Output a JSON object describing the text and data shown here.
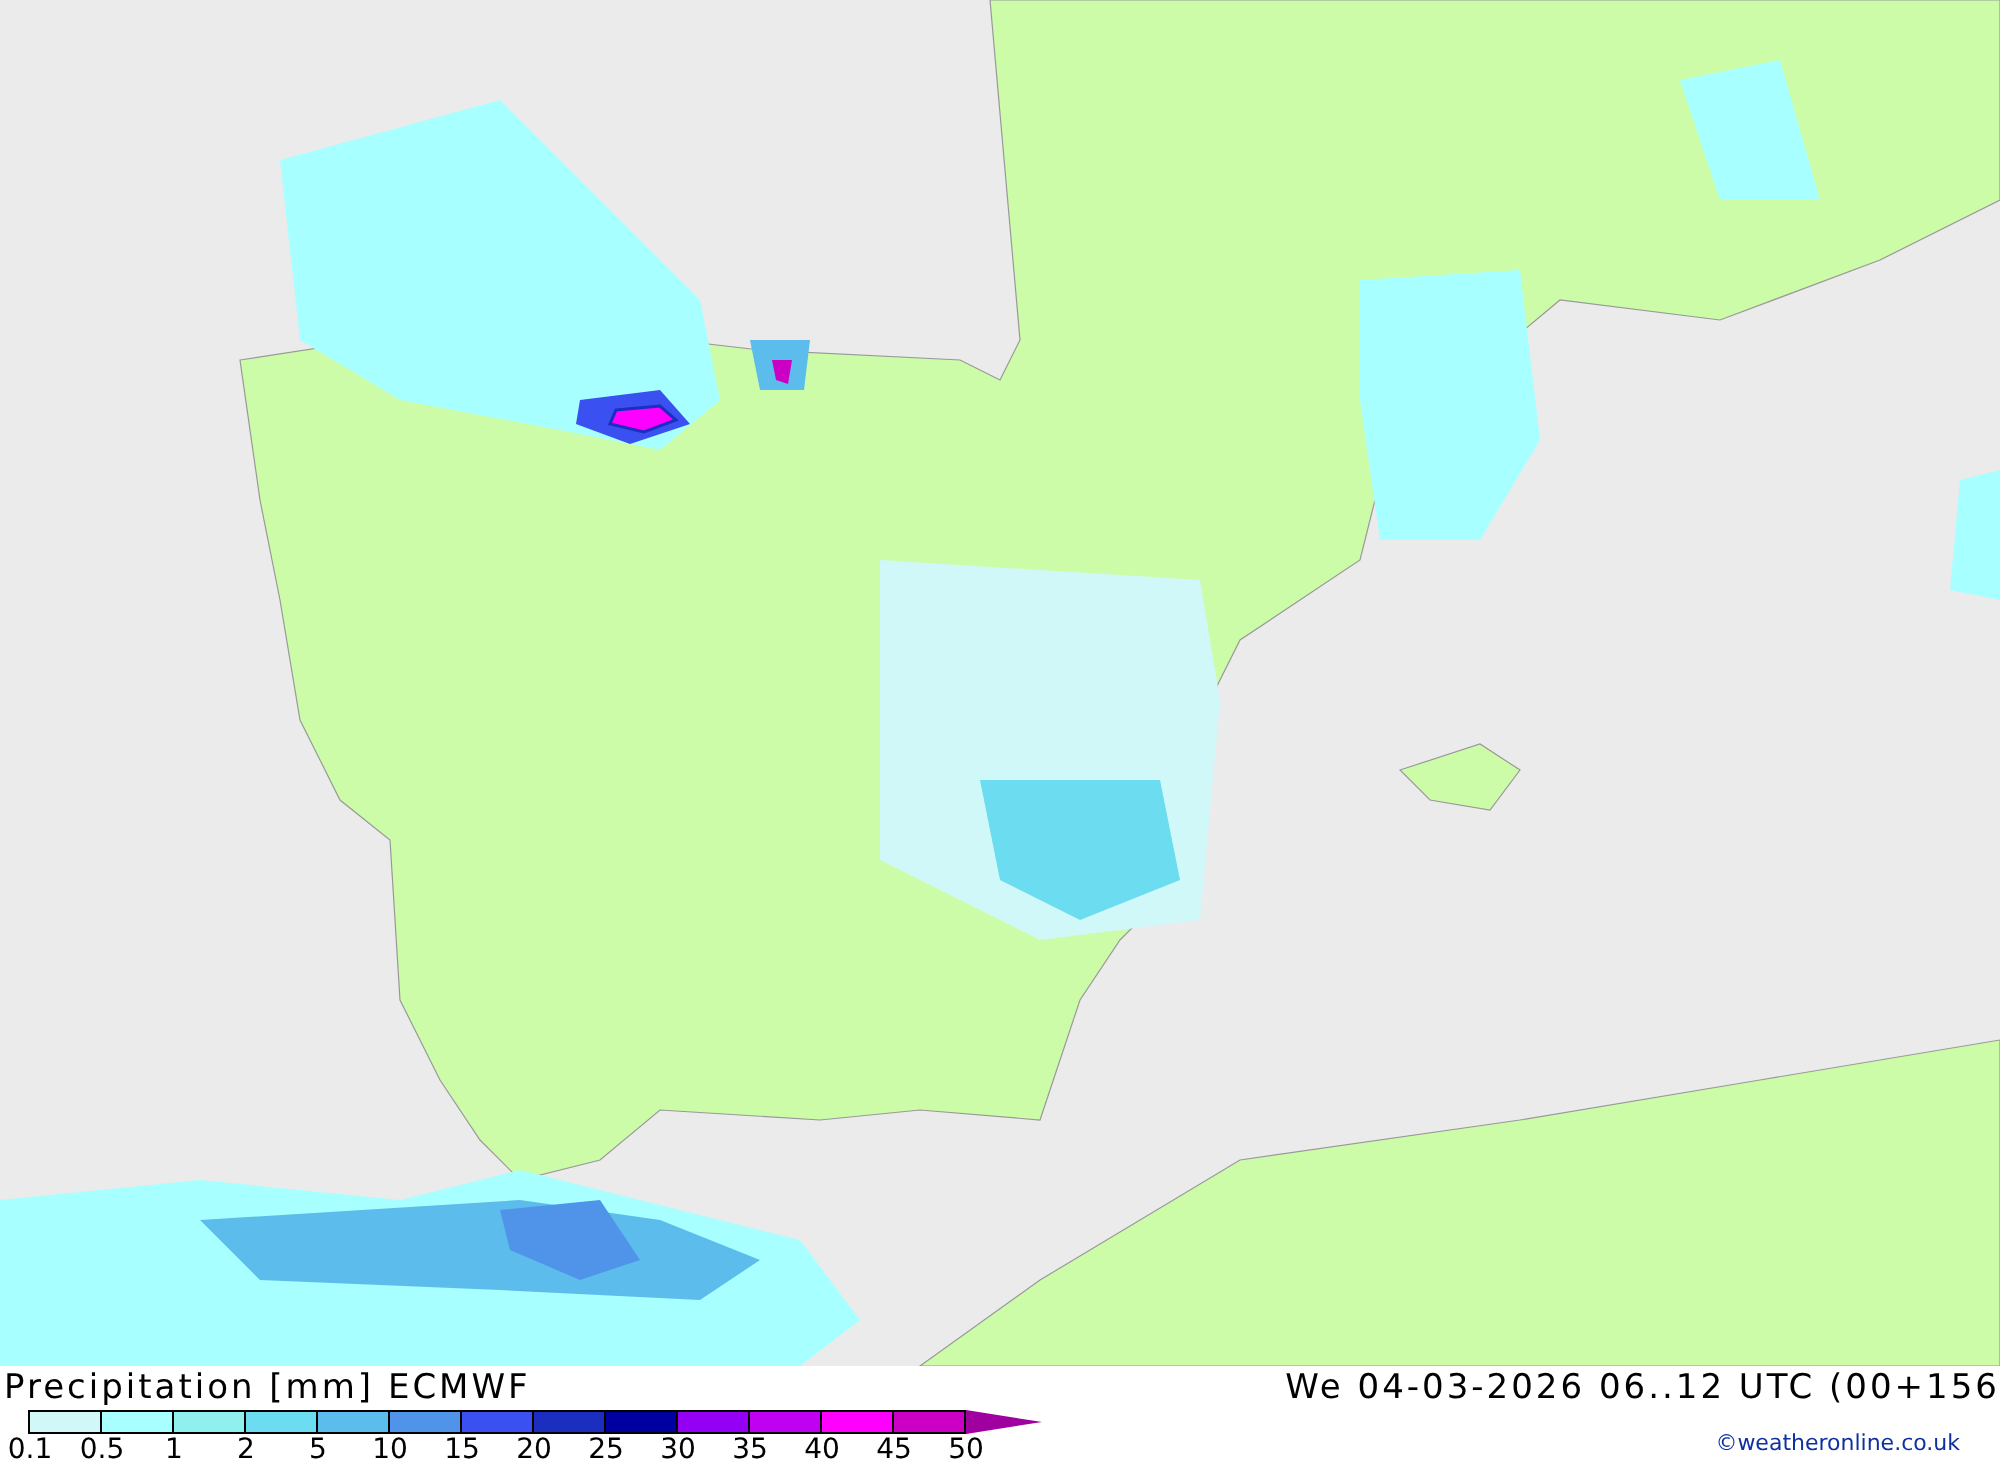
{
  "legend": {
    "title": "Precipitation [mm] ECMWF",
    "swatches": [
      {
        "color": "#d0f8f8"
      },
      {
        "color": "#a8ffff"
      },
      {
        "color": "#90f0ee"
      },
      {
        "color": "#6cdcf0"
      },
      {
        "color": "#5cbcec"
      },
      {
        "color": "#5094ea"
      },
      {
        "color": "#3a50f0"
      },
      {
        "color": "#1c2ec0"
      },
      {
        "color": "#0000a0"
      },
      {
        "color": "#9400f4"
      },
      {
        "color": "#c000f0"
      },
      {
        "color": "#ff00ff"
      },
      {
        "color": "#cc00c4"
      }
    ],
    "labels": [
      "0.1",
      "0.5",
      "1",
      "2",
      "5",
      "10",
      "15",
      "20",
      "25",
      "30",
      "35",
      "40",
      "45",
      "50"
    ]
  },
  "run_time": "We 04-03-2026 06..12 UTC (00+156",
  "credit": "©weatheronline.co.uk"
}
